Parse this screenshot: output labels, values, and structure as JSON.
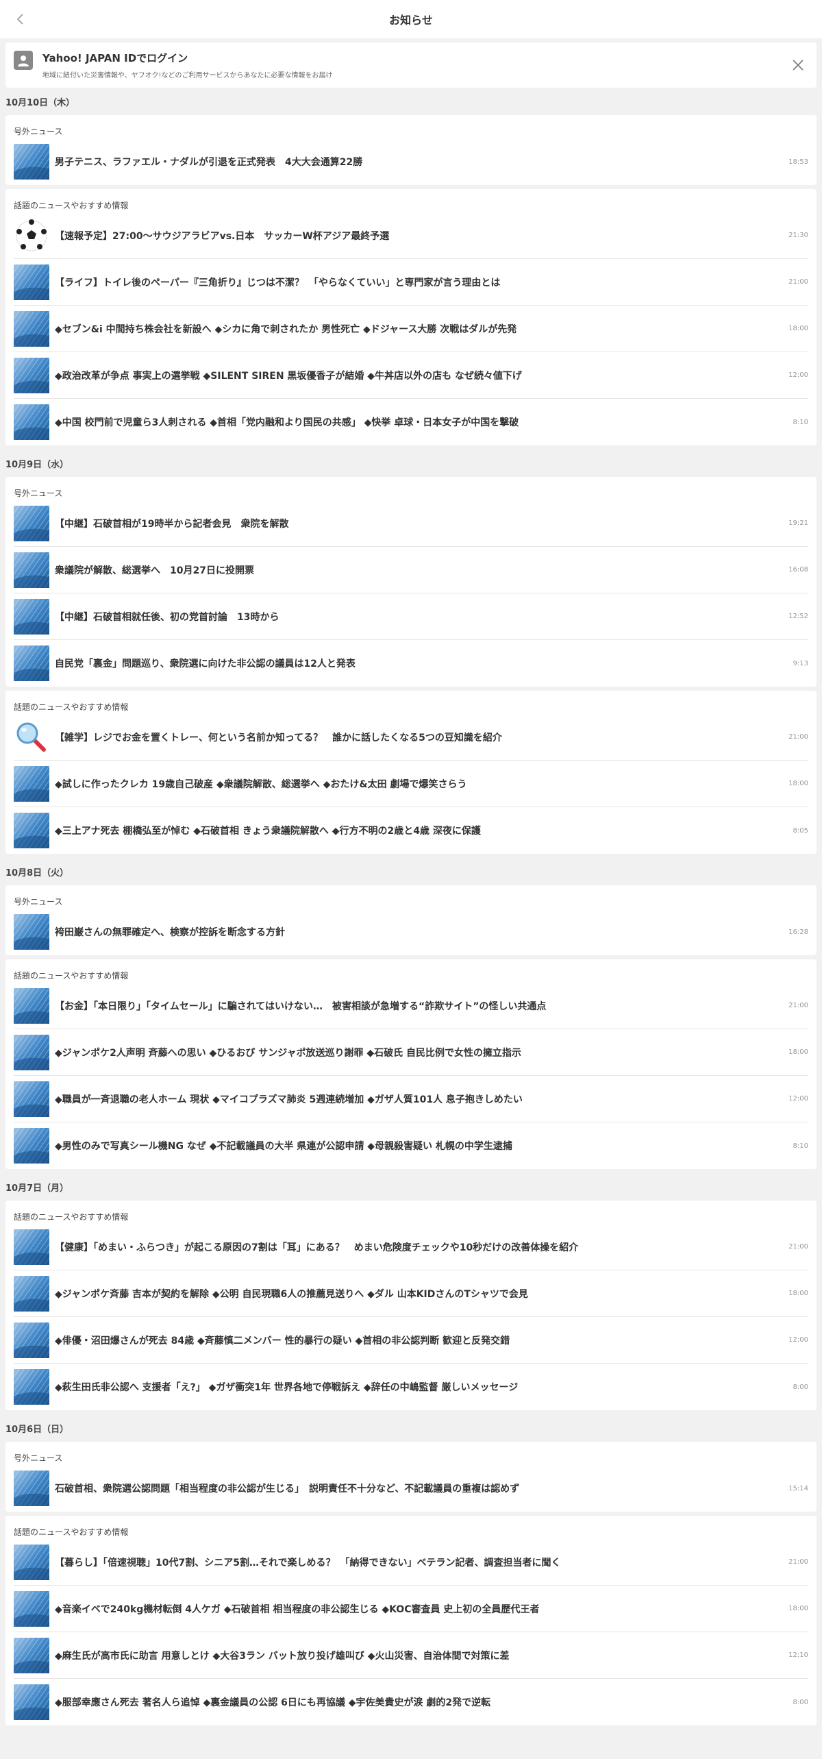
{
  "header": {
    "title": "お知らせ"
  },
  "login": {
    "title": "Yahoo! JAPAN IDでログイン",
    "description": "地域に紐付いた災害情報や、ヤフオク!などのご利用サービスからあなたに必要な情報をお届け"
  },
  "colors": {
    "background": "#f1f1f1",
    "card": "#ffffff",
    "text": "#333333",
    "time": "#999999"
  },
  "days": [
    {
      "date": "10月10日（木）",
      "sections": [
        {
          "heading": "号外ニュース",
          "items": [
            {
              "title": "男子テニス、ラファエル・ナダルが引退を正式発表　4大大会通算22勝",
              "time": "18:53",
              "icon": "news-thumb"
            }
          ]
        },
        {
          "heading": "話題のニュースやおすすめ情報",
          "items": [
            {
              "title": "【速報予定】27:00〜サウジアラビアvs.日本　サッカーW杯アジア最終予選",
              "time": "21:30",
              "icon": "soccer-ball"
            },
            {
              "title": "【ライフ】トイレ後のペーパー『三角折り』じつは不潔？　「やらなくていい」と専門家が言う理由とは",
              "time": "21:00",
              "icon": "news-thumb"
            },
            {
              "title": "◆セブン&i 中間持ち株会社を新設へ ◆シカに角で刺されたか 男性死亡 ◆ドジャース大勝 次戦はダルが先発",
              "time": "18:00",
              "icon": "news-thumb"
            },
            {
              "title": "◆政治改革が争点 事実上の選挙戦 ◆SILENT SIREN 黒坂優香子が結婚 ◆牛丼店以外の店も なぜ続々値下げ",
              "time": "12:00",
              "icon": "news-thumb"
            },
            {
              "title": "◆中国 校門前で児童ら3人刺される ◆首相「党内融和より国民の共感」 ◆快挙 卓球・日本女子が中国を撃破",
              "time": "8:10",
              "icon": "news-thumb"
            }
          ]
        }
      ]
    },
    {
      "date": "10月9日（水）",
      "sections": [
        {
          "heading": "号外ニュース",
          "items": [
            {
              "title": "【中継】石破首相が19時半から記者会見　衆院を解散",
              "time": "19:21",
              "icon": "news-thumb"
            },
            {
              "title": "衆議院が解散、総選挙へ　10月27日に投開票",
              "time": "16:08",
              "icon": "news-thumb"
            },
            {
              "title": "【中継】石破首相就任後、初の党首討論　13時から",
              "time": "12:52",
              "icon": "news-thumb"
            },
            {
              "title": "自民党「裏金」問題巡り、衆院選に向けた非公認の議員は12人と発表",
              "time": "9:13",
              "icon": "news-thumb"
            }
          ]
        },
        {
          "heading": "話題のニュースやおすすめ情報",
          "items": [
            {
              "title": "【雑学】レジでお金を置くトレー、何という名前か知ってる？　誰かに話したくなる5つの豆知識を紹介",
              "time": "21:00",
              "icon": "magnifier"
            },
            {
              "title": "◆試しに作ったクレカ 19歳自己破産 ◆衆議院解散、総選挙へ ◆おたけ&太田 劇場で爆笑さらう",
              "time": "18:00",
              "icon": "news-thumb"
            },
            {
              "title": "◆三上アナ死去 棚橋弘至が悼む ◆石破首相 きょう衆議院解散へ ◆行方不明の2歳と4歳 深夜に保護",
              "time": "8:05",
              "icon": "news-thumb"
            }
          ]
        }
      ]
    },
    {
      "date": "10月8日（火）",
      "sections": [
        {
          "heading": "号外ニュース",
          "items": [
            {
              "title": "袴田巌さんの無罪確定へ、検察が控訴を断念する方針",
              "time": "16:28",
              "icon": "news-thumb"
            }
          ]
        },
        {
          "heading": "話題のニュースやおすすめ情報",
          "items": [
            {
              "title": "【お金】「本日限り」「タイムセール」に騙されてはいけない…　被害相談が急増する“詐欺サイト”の怪しい共通点",
              "time": "21:00",
              "icon": "news-thumb"
            },
            {
              "title": "◆ジャンポケ2人声明 斉藤への思い ◆ひるおび サンジャポ放送巡り謝罪 ◆石破氏 自民比例で女性の擁立指示",
              "time": "18:00",
              "icon": "news-thumb"
            },
            {
              "title": "◆職員が一斉退職の老人ホーム 現状 ◆マイコプラズマ肺炎 5週連続増加 ◆ガザ人質101人 息子抱きしめたい",
              "time": "12:00",
              "icon": "news-thumb"
            },
            {
              "title": "◆男性のみで写真シール機NG なぜ ◆不記載議員の大半 県連が公認申請 ◆母親殺害疑い 札幌の中学生逮捕",
              "time": "8:10",
              "icon": "news-thumb"
            }
          ]
        }
      ]
    },
    {
      "date": "10月7日（月）",
      "sections": [
        {
          "heading": "話題のニュースやおすすめ情報",
          "items": [
            {
              "title": "【健康】「めまい・ふらつき」が起こる原因の7割は「耳」にある？　めまい危険度チェックや10秒だけの改善体操を紹介",
              "time": "21:00",
              "icon": "news-thumb"
            },
            {
              "title": "◆ジャンポケ斉藤 吉本が契約を解除 ◆公明 自民現職6人の推薦見送りへ ◆ダル 山本KIDさんのTシャツで会見",
              "time": "18:00",
              "icon": "news-thumb"
            },
            {
              "title": "◆俳優・沼田爆さんが死去 84歳 ◆斉藤慎二メンバー 性的暴行の疑い ◆首相の非公認判断 歓迎と反発交錯",
              "time": "12:00",
              "icon": "news-thumb"
            },
            {
              "title": "◆萩生田氏非公認へ 支援者「え?」 ◆ガザ衝突1年 世界各地で停戦訴え ◆辞任の中嶋監督 厳しいメッセージ",
              "time": "8:00",
              "icon": "news-thumb"
            }
          ]
        }
      ]
    },
    {
      "date": "10月6日（日）",
      "sections": [
        {
          "heading": "号外ニュース",
          "items": [
            {
              "title": "石破首相、衆院選公認問題「相当程度の非公認が生じる」　説明責任不十分など、不記載議員の重複は認めず",
              "time": "15:14",
              "icon": "news-thumb"
            }
          ]
        },
        {
          "heading": "話題のニュースやおすすめ情報",
          "items": [
            {
              "title": "【暮らし】「倍速視聴」10代7割、シニア5割…それで楽しめる？　「納得できない」ベテラン記者、調査担当者に聞く",
              "time": "21:00",
              "icon": "news-thumb"
            },
            {
              "title": "◆音楽イベで240kg機材転倒 4人ケガ ◆石破首相 相当程度の非公認生じる ◆KOC審査員 史上初の全員歴代王者",
              "time": "18:00",
              "icon": "news-thumb"
            },
            {
              "title": "◆麻生氏が高市氏に助言 用意しとけ ◆大谷3ラン バット放り投げ雄叫び ◆火山災害、自治体間で対策に差",
              "time": "12:10",
              "icon": "news-thumb"
            },
            {
              "title": "◆服部幸應さん死去 著名人ら追悼 ◆裏金議員の公認 6日にも再協議 ◆宇佐美貴史が涙 劇的2発で逆転",
              "time": "8:00",
              "icon": "news-thumb"
            }
          ]
        }
      ]
    }
  ]
}
